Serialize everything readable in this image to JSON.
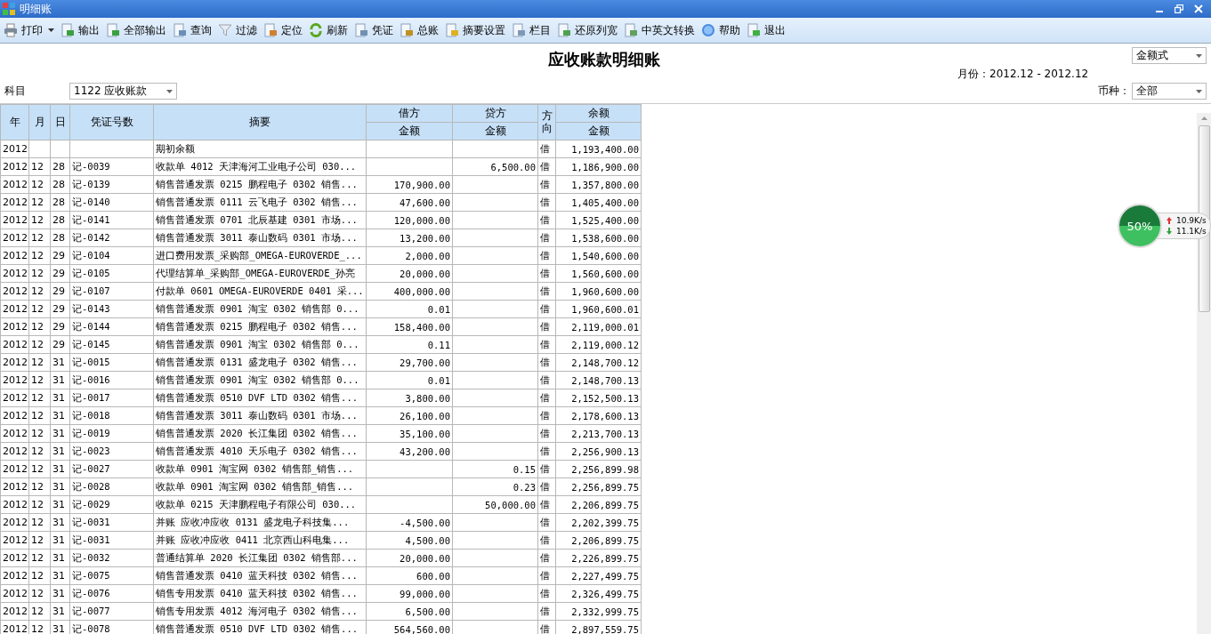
{
  "window": {
    "title": "明细账"
  },
  "toolbar": [
    {
      "kind": "print",
      "label": "打印",
      "dropdown": true
    },
    {
      "kind": "export",
      "label": "输出",
      "dropdown": false
    },
    {
      "kind": "export_all",
      "label": "全部输出",
      "dropdown": false
    },
    {
      "kind": "query",
      "label": "查询",
      "dropdown": false
    },
    {
      "kind": "filter",
      "label": "过滤",
      "dropdown": false
    },
    {
      "kind": "locate",
      "label": "定位",
      "dropdown": false
    },
    {
      "kind": "refresh",
      "label": "刷新",
      "dropdown": false
    },
    {
      "kind": "voucher",
      "label": "凭证",
      "dropdown": false
    },
    {
      "kind": "ledger",
      "label": "总账",
      "dropdown": false
    },
    {
      "kind": "new",
      "label": "摘要设置",
      "dropdown": false
    },
    {
      "kind": "columns",
      "label": "栏目",
      "dropdown": false
    },
    {
      "kind": "restore",
      "label": "还原列宽",
      "dropdown": false
    },
    {
      "kind": "translate",
      "label": "中英文转换",
      "dropdown": false
    },
    {
      "kind": "help",
      "label": "帮助",
      "dropdown": false
    },
    {
      "kind": "exit",
      "label": "退出",
      "dropdown": false
    }
  ],
  "report": {
    "title": "应收账款明细账",
    "format": "金额式",
    "period": "月份：2012.12 - 2012.12",
    "subject_label": "科目",
    "subject": "1122 应收账款",
    "currency_label": "币种：",
    "currency": "全部"
  },
  "table": {
    "columns": [
      "年",
      "月",
      "日",
      "凭证号数",
      "摘要",
      "借方",
      "贷方",
      "方向",
      "余额"
    ],
    "subcolumns": [
      "金额",
      "金额",
      "金额"
    ],
    "rows": [
      [
        "2012",
        "",
        "",
        "",
        "期初余额",
        "",
        "",
        "借",
        "1,193,400.00"
      ],
      [
        "2012",
        "12",
        "28",
        "记-0039",
        "收款单 4012 天津海河工业电子公司 030...",
        "",
        "6,500.00",
        "借",
        "1,186,900.00"
      ],
      [
        "2012",
        "12",
        "28",
        "记-0139",
        "销售普通发票 0215 鹏程电子 0302 销售...",
        "170,900.00",
        "",
        "借",
        "1,357,800.00"
      ],
      [
        "2012",
        "12",
        "28",
        "记-0140",
        "销售普通发票 0111 云飞电子 0302 销售...",
        "47,600.00",
        "",
        "借",
        "1,405,400.00"
      ],
      [
        "2012",
        "12",
        "28",
        "记-0141",
        "销售普通发票 0701 北辰基建 0301 市场...",
        "120,000.00",
        "",
        "借",
        "1,525,400.00"
      ],
      [
        "2012",
        "12",
        "28",
        "记-0142",
        "销售普通发票 3011 泰山数码 0301 市场...",
        "13,200.00",
        "",
        "借",
        "1,538,600.00"
      ],
      [
        "2012",
        "12",
        "29",
        "记-0104",
        "进口费用发票_采购部_OMEGA-EUROVERDE_...",
        "2,000.00",
        "",
        "借",
        "1,540,600.00"
      ],
      [
        "2012",
        "12",
        "29",
        "记-0105",
        "代理结算单_采购部_OMEGA-EUROVERDE_孙亮",
        "20,000.00",
        "",
        "借",
        "1,560,600.00"
      ],
      [
        "2012",
        "12",
        "29",
        "记-0107",
        "付款单 0601 OMEGA-EUROVERDE 0401 采...",
        "400,000.00",
        "",
        "借",
        "1,960,600.00"
      ],
      [
        "2012",
        "12",
        "29",
        "记-0143",
        "销售普通发票 0901 淘宝 0302 销售部 0...",
        "0.01",
        "",
        "借",
        "1,960,600.01"
      ],
      [
        "2012",
        "12",
        "29",
        "记-0144",
        "销售普通发票 0215 鹏程电子 0302 销售...",
        "158,400.00",
        "",
        "借",
        "2,119,000.01"
      ],
      [
        "2012",
        "12",
        "29",
        "记-0145",
        "销售普通发票 0901 淘宝 0302 销售部 0...",
        "0.11",
        "",
        "借",
        "2,119,000.12"
      ],
      [
        "2012",
        "12",
        "31",
        "记-0015",
        "销售普通发票 0131 盛龙电子 0302 销售...",
        "29,700.00",
        "",
        "借",
        "2,148,700.12"
      ],
      [
        "2012",
        "12",
        "31",
        "记-0016",
        "销售普通发票 0901 淘宝 0302 销售部 0...",
        "0.01",
        "",
        "借",
        "2,148,700.13"
      ],
      [
        "2012",
        "12",
        "31",
        "记-0017",
        "销售普通发票 0510 DVF LTD 0302 销售...",
        "3,800.00",
        "",
        "借",
        "2,152,500.13"
      ],
      [
        "2012",
        "12",
        "31",
        "记-0018",
        "销售普通发票 3011 泰山数码 0301 市场...",
        "26,100.00",
        "",
        "借",
        "2,178,600.13"
      ],
      [
        "2012",
        "12",
        "31",
        "记-0019",
        "销售普通发票 2020 长江集团 0302 销售...",
        "35,100.00",
        "",
        "借",
        "2,213,700.13"
      ],
      [
        "2012",
        "12",
        "31",
        "记-0023",
        "销售普通发票 4010 天乐电子 0302 销售...",
        "43,200.00",
        "",
        "借",
        "2,256,900.13"
      ],
      [
        "2012",
        "12",
        "31",
        "记-0027",
        "收款单 0901 淘宝网 0302 销售部_销售...",
        "",
        "0.15",
        "借",
        "2,256,899.98"
      ],
      [
        "2012",
        "12",
        "31",
        "记-0028",
        "收款单 0901 淘宝网 0302 销售部_销售...",
        "",
        "0.23",
        "借",
        "2,256,899.75"
      ],
      [
        "2012",
        "12",
        "31",
        "记-0029",
        "收款单 0215 天津鹏程电子有限公司 030...",
        "",
        "50,000.00",
        "借",
        "2,206,899.75"
      ],
      [
        "2012",
        "12",
        "31",
        "记-0031",
        "并账 应收冲应收 0131 盛龙电子科技集...",
        "-4,500.00",
        "",
        "借",
        "2,202,399.75"
      ],
      [
        "2012",
        "12",
        "31",
        "记-0031",
        "并账 应收冲应收 0411 北京西山科电集...",
        "4,500.00",
        "",
        "借",
        "2,206,899.75"
      ],
      [
        "2012",
        "12",
        "31",
        "记-0032",
        "普通结算单 2020 长江集团 0302 销售部...",
        "20,000.00",
        "",
        "借",
        "2,226,899.75"
      ],
      [
        "2012",
        "12",
        "31",
        "记-0075",
        "销售普通发票 0410 蓝天科技 0302 销售...",
        "600.00",
        "",
        "借",
        "2,227,499.75"
      ],
      [
        "2012",
        "12",
        "31",
        "记-0076",
        "销售专用发票 0410 蓝天科技 0302 销售...",
        "99,000.00",
        "",
        "借",
        "2,326,499.75"
      ],
      [
        "2012",
        "12",
        "31",
        "记-0077",
        "销售专用发票 4012 海河电子 0302 销售...",
        "6,500.00",
        "",
        "借",
        "2,332,999.75"
      ],
      [
        "2012",
        "12",
        "31",
        "记-0078",
        "销售普通发票 0510 DVF LTD 0302 销售...",
        "564,560.00",
        "",
        "借",
        "2,897,559.75"
      ]
    ]
  },
  "speed_widget": {
    "percent": "50%",
    "upload": "10.9K/s",
    "download": "11.1K/s"
  }
}
